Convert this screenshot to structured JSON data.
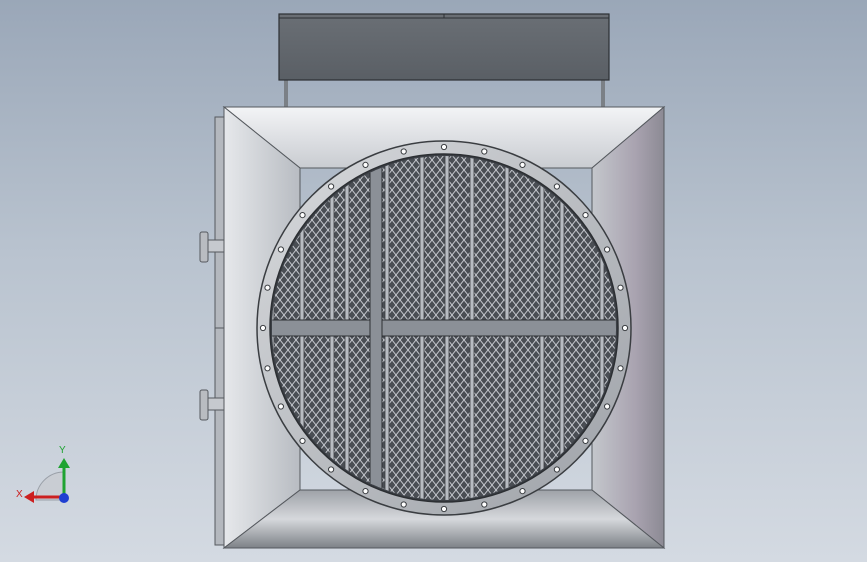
{
  "viewport": {
    "colors": {
      "background_top": "#9aa7b8",
      "background_bottom": "#d4dae2",
      "steel_light": "#e4e6ea",
      "steel_mid": "#a8acb2",
      "steel_dark": "#5c6066",
      "grille": "#55595f"
    }
  },
  "triad": {
    "x_label": "X",
    "y_label": "Y",
    "x_color": "#cc1f1f",
    "y_color": "#1fa332",
    "z_color": "#1f3fd1"
  }
}
